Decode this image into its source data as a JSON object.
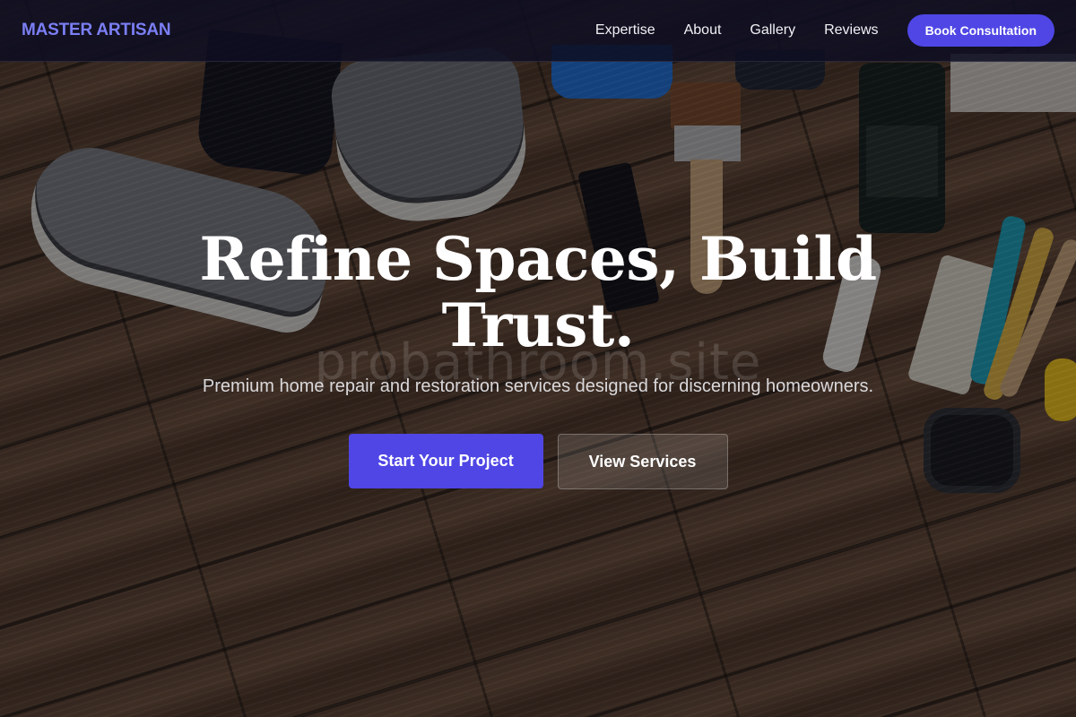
{
  "brand": {
    "name": "MASTER ARTISAN",
    "accent_color": "#4f46e5",
    "logo_color": "#7b7ff5"
  },
  "nav": {
    "links": [
      {
        "label": "Expertise"
      },
      {
        "label": "About"
      },
      {
        "label": "Gallery"
      },
      {
        "label": "Reviews"
      }
    ],
    "cta_label": "Book Consultation"
  },
  "hero": {
    "title": "Refine Spaces, Build Trust.",
    "subtitle": "Premium home repair and restoration services designed for discerning homeowners.",
    "primary_button": "Start Your Project",
    "secondary_button": "View Services",
    "background_image": "wood-floor-with-sneakers-and-painting-tools"
  },
  "watermark": "probathroom.site"
}
